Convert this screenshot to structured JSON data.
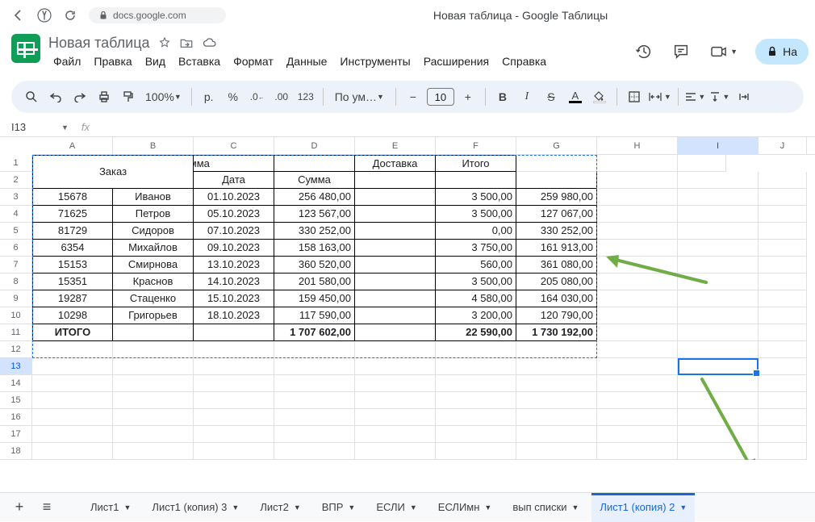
{
  "browser": {
    "url_host": "docs.google.com",
    "page_title": "Новая таблица - Google Таблицы"
  },
  "doc": {
    "title": "Новая таблица",
    "share": "На"
  },
  "menu": [
    "Файл",
    "Правка",
    "Вид",
    "Вставка",
    "Формат",
    "Данные",
    "Инструменты",
    "Расширения",
    "Справка"
  ],
  "toolbar": {
    "zoom": "100%",
    "currency": "р.",
    "pct": "%",
    "fmt123": "123",
    "font": "По ум…",
    "size": "10"
  },
  "namebox": "I13",
  "columns": [
    "A",
    "B",
    "C",
    "D",
    "E",
    "F",
    "G",
    "H",
    "I",
    "J"
  ],
  "rows": [
    1,
    2,
    3,
    4,
    5,
    6,
    7,
    8,
    9,
    10,
    11,
    12,
    13,
    14,
    15,
    16,
    17,
    18
  ],
  "table": {
    "h_order": "Заказ",
    "h_sum_top": "Сумма",
    "h_delivery": "Доставка",
    "h_total": "Итого",
    "h_date": "Дата",
    "h_sum": "Сумма",
    "rows": [
      {
        "a": "15678",
        "b": "Иванов",
        "c": "01.10.2023",
        "d": "256 480,00",
        "f": "3 500,00",
        "g": "259 980,00"
      },
      {
        "a": "71625",
        "b": "Петров",
        "c": "05.10.2023",
        "d": "123 567,00",
        "f": "3 500,00",
        "g": "127 067,00"
      },
      {
        "a": "81729",
        "b": "Сидоров",
        "c": "07.10.2023",
        "d": "330 252,00",
        "f": "0,00",
        "g": "330 252,00"
      },
      {
        "a": "6354",
        "b": "Михайлов",
        "c": "09.10.2023",
        "d": "158 163,00",
        "f": "3 750,00",
        "g": "161 913,00"
      },
      {
        "a": "15153",
        "b": "Смирнова",
        "c": "13.10.2023",
        "d": "360 520,00",
        "f": "560,00",
        "g": "361 080,00"
      },
      {
        "a": "15351",
        "b": "Краснов",
        "c": "14.10.2023",
        "d": "201 580,00",
        "f": "3 500,00",
        "g": "205 080,00"
      },
      {
        "a": "19287",
        "b": "Стаценко",
        "c": "15.10.2023",
        "d": "159 450,00",
        "f": "4 580,00",
        "g": "164 030,00"
      },
      {
        "a": "10298",
        "b": "Григорьев",
        "c": "18.10.2023",
        "d": "117 590,00",
        "f": "3 200,00",
        "g": "120 790,00"
      }
    ],
    "footer": {
      "label": "ИТОГО",
      "d": "1 707 602,00",
      "f": "22 590,00",
      "g": "1 730 192,00"
    }
  },
  "tabs": [
    "Лист1",
    "Лист1 (копия) 3",
    "Лист2",
    "ВПР",
    "ЕСЛИ",
    "ЕСЛИмн",
    "вып списки",
    "Лист1 (копия) 2"
  ]
}
